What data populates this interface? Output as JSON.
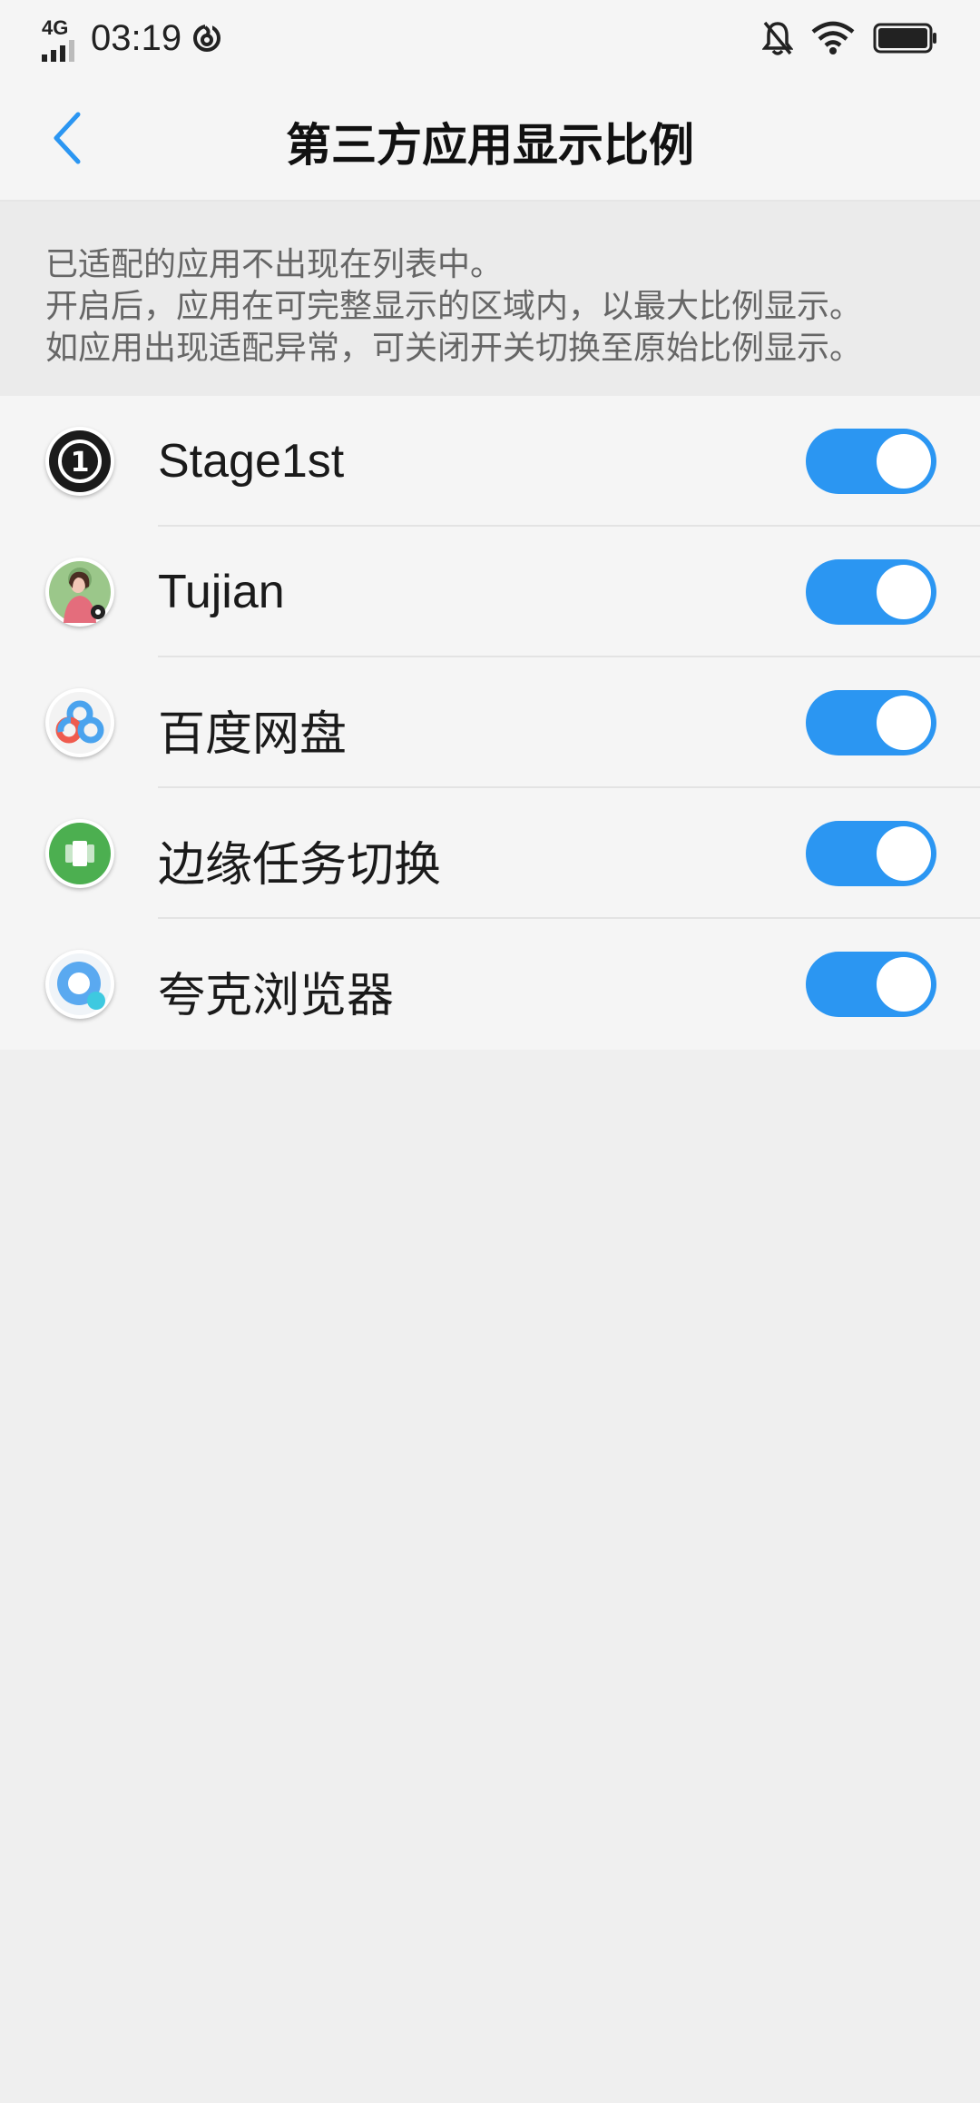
{
  "status_bar": {
    "network": "4G",
    "time": "03:19",
    "icons": [
      "signal-bars-icon",
      "sync-icon",
      "bell-off-icon",
      "wifi-icon",
      "battery-icon"
    ]
  },
  "nav": {
    "back_icon": "chevron-left-icon",
    "title": "第三方应用显示比例"
  },
  "description": {
    "lines": [
      "已适配的应用不出现在列表中。",
      "开启后，应用在可完整显示的区域内，以最大比例显示。",
      "如应用出现适配异常，可关闭开关切换至原始比例显示。"
    ]
  },
  "apps": [
    {
      "name": "Stage1st",
      "icon": "stage1st-icon",
      "enabled": true
    },
    {
      "name": "Tujian",
      "icon": "tujian-icon",
      "enabled": true
    },
    {
      "name": "百度网盘",
      "icon": "baidu-netdisk-icon",
      "enabled": true
    },
    {
      "name": "边缘任务切换",
      "icon": "edge-task-switch-icon",
      "enabled": true
    },
    {
      "name": "夸克浏览器",
      "icon": "quark-browser-icon",
      "enabled": true
    }
  ],
  "colors": {
    "accent": "#2b96f2",
    "page_bg": "#efefef",
    "list_bg": "#f5f5f5"
  }
}
